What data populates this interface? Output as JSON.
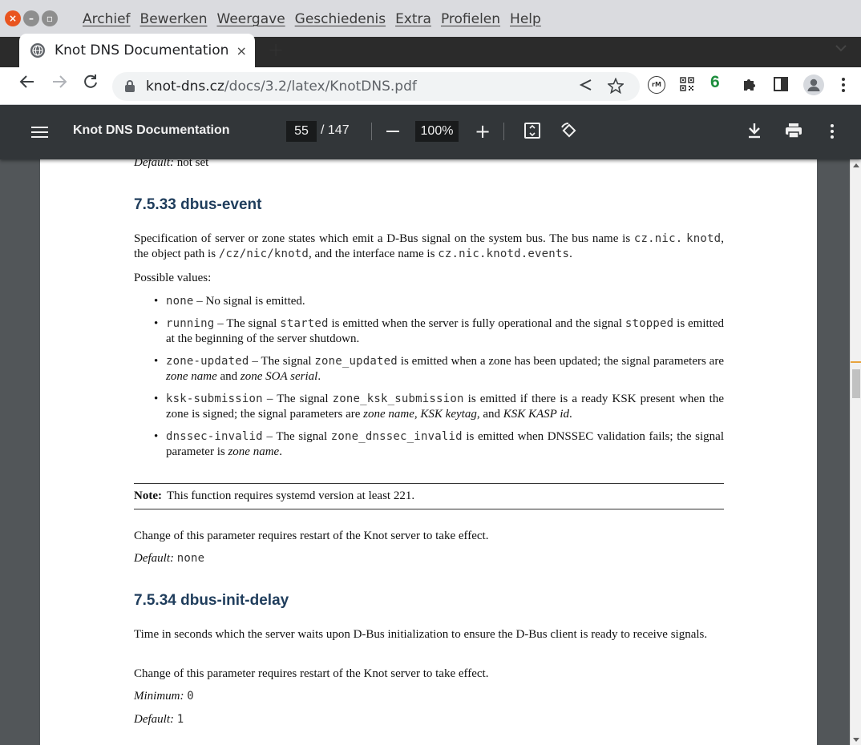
{
  "window": {
    "menu": [
      "Archief",
      "Bewerken",
      "Weergave",
      "Geschiedenis",
      "Extra",
      "Profielen",
      "Help"
    ]
  },
  "tab": {
    "title": "Knot DNS Documentation",
    "close": "×",
    "new_tab": "+"
  },
  "address_bar": {
    "domain": "knot-dns.cz",
    "path": "/docs/3.2/latex/KnotDNS.pdf"
  },
  "extensions": {
    "rm_label": "rM",
    "badge_count": "6"
  },
  "pdf_toolbar": {
    "title": "Knot DNS Documentation",
    "current_page": "55",
    "total_pages": "/ 147",
    "zoom": "100%"
  },
  "document": {
    "prev_default_label": "Default:",
    "prev_default_value": "not set",
    "section1": {
      "heading": "7.5.33 dbus-event",
      "intro_parts": [
        "Specification of server or zone states which emit a D-Bus signal on the system bus. The bus name is ",
        "cz.nic.",
        "knotd",
        ", the object path is ",
        "/cz/nic/knotd",
        ", and the interface name is ",
        "cz.nic.knotd.events",
        "."
      ],
      "possible_values": "Possible values:",
      "items": [
        {
          "code": "none",
          "text": " – No signal is emitted."
        },
        {
          "code": "running",
          "text": " – The signal ",
          "code2": "started",
          "text2": " is emitted when the server is fully operational and the signal ",
          "code3": "stopped",
          "text3": " is emitted at the beginning of the server shutdown."
        },
        {
          "code": "zone-updated",
          "text": " – The signal ",
          "code2": "zone_updated",
          "text2": " is emitted when a zone has been updated; the signal parameters are ",
          "em1": "zone name",
          "text3": " and ",
          "em2": "zone SOA serial",
          "text4": "."
        },
        {
          "code": "ksk-submission",
          "text": " – The signal ",
          "code2": "zone_ksk_submission",
          "text2": " is emitted if there is a ready KSK present when the zone is signed; the signal parameters are ",
          "em1": "zone name",
          "text3": ", ",
          "em2": "KSK keytag",
          "text4": ", and ",
          "em3": "KSK KASP id",
          "text5": "."
        },
        {
          "code": "dnssec-invalid",
          "text": " – The signal ",
          "code2": "zone_dnssec_invalid",
          "text2": " is emitted when DNSSEC validation fails; the signal parameter is ",
          "em1": "zone name",
          "text3": "."
        }
      ],
      "note_label": "Note:",
      "note_text": "This function requires systemd version at least 221.",
      "restart": "Change of this parameter requires restart of the Knot server to take effect.",
      "default_label": "Default:",
      "default_value": "none"
    },
    "section2": {
      "heading": "7.5.34 dbus-init-delay",
      "intro": "Time in seconds which the server waits upon D-Bus initialization to ensure the D-Bus client is ready to receive signals.",
      "restart": "Change of this parameter requires restart of the Knot server to take effect.",
      "minimum_label": "Minimum:",
      "minimum_value": "0",
      "default_label": "Default:",
      "default_value": "1"
    }
  }
}
